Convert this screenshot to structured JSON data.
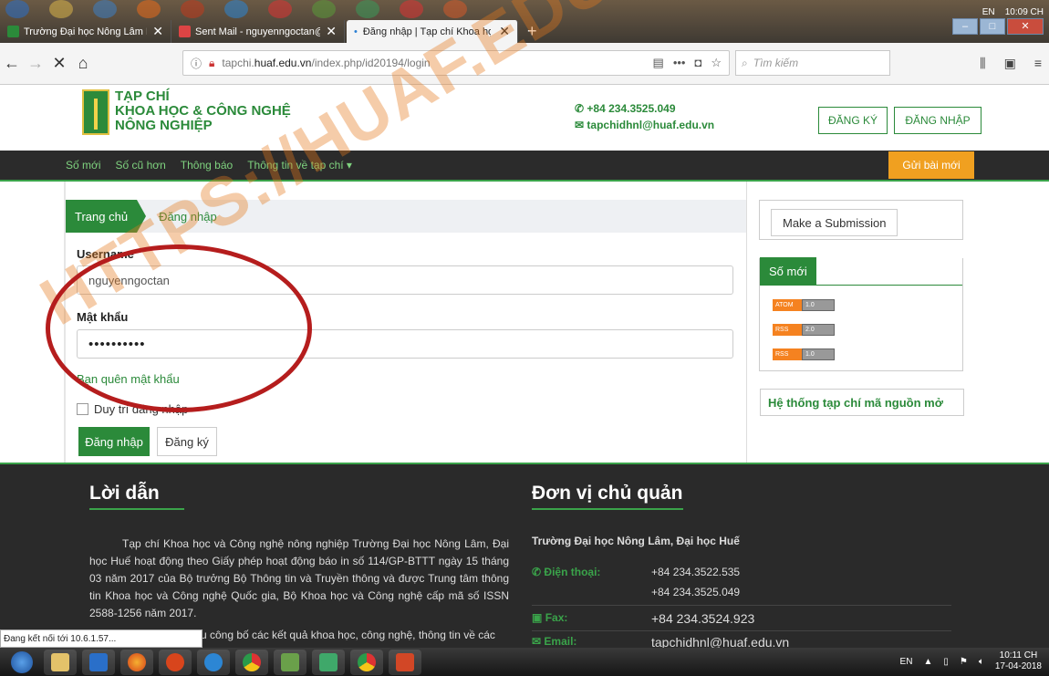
{
  "browser": {
    "tabs": [
      {
        "label": "Trường Đại học Nông Lâm Huế"
      },
      {
        "label": "Sent Mail - nguyenngoctan@h"
      },
      {
        "label": "Đăng nhập | Tạp chí Khoa học"
      }
    ],
    "url_prefix": "tapchi.",
    "url_domain": "huaf.edu.vn",
    "url_path": "/index.php/id20194/login",
    "search_placeholder": "Tìm kiếm",
    "top_clock": "10:09 CH",
    "top_lang": "EN",
    "status_text": "Đang kết nối tới 10.6.1.57..."
  },
  "header": {
    "logo_line1": "TẠP CHÍ",
    "logo_line2": "KHOA HỌC & CÔNG NGHỆ",
    "logo_line3": "NÔNG NGHIỆP",
    "phone": "+84 234.3525.049",
    "email": "tapchidhnl@huaf.edu.vn",
    "register": "ĐĂNG KÝ",
    "login": "ĐĂNG NHẬP"
  },
  "menu": {
    "items": [
      {
        "label": "Số mới"
      },
      {
        "label": "Số cũ hơn"
      },
      {
        "label": "Thông báo"
      },
      {
        "label": "Thông tin về tạp chí ▾"
      }
    ],
    "submit": "Gửi bài mới"
  },
  "breadcrumb": {
    "home": "Trang chủ",
    "current": "Đăng nhập"
  },
  "form": {
    "username_label": "Username",
    "username_value": "nguyenngoctan",
    "password_label": "Mật khẩu",
    "password_value": "••••••••••",
    "forgot": "Bạn quên mật khẩu",
    "remember": "Duy trì đăng nhập",
    "login_button": "Đăng nhập",
    "register_button": "Đăng ký"
  },
  "sidebar": {
    "make_submission": "Make a Submission",
    "current_issue": "Số mới",
    "feeds": [
      {
        "type": "ATOM",
        "version": "1.0"
      },
      {
        "type": "RSS",
        "version": "2.0"
      },
      {
        "type": "RSS",
        "version": "1.0"
      }
    ],
    "oss": "Hệ thống tạp chí mã nguồn mở"
  },
  "footer": {
    "left_title": "Lời dẫn",
    "paragraph": "Tạp chí Khoa học và Công nghệ nông nghiệp Trường Đại học Nông Lâm, Đại học Huế hoạt động theo Giấy phép hoạt động báo in số 114/GP-BTTT ngày 15 tháng 03 năm 2017 của Bộ trưởng Bộ Thông tin và Truyền thông và được Trung tâm thông tin Khoa học và Công nghệ Quốc gia, Bộ Khoa học và Công nghệ cấp mã số ISSN 2588-1256 năm 2017.",
    "paragraph2": "u công bố các kết quả khoa học, công nghệ, thông tin về các",
    "right_title": "Đơn vị chủ quản",
    "org": "Trường Đại học Nông Lâm, Đại học Huế",
    "phone_label": "Điện thoại:",
    "phone1": "+84 234.3522.535",
    "phone2": "+84 234.3525.049",
    "fax_label": "Fax:",
    "fax": "+84 234.3524.923",
    "email_label": "Email:",
    "email": "tapchidhnl@huaf.edu.vn"
  },
  "taskbar": {
    "lang": "EN",
    "time": "10:11 CH",
    "date": "17-04-2018"
  },
  "overlay": {
    "watermark": "HTTPS://HUAF.EDU.VN/"
  }
}
